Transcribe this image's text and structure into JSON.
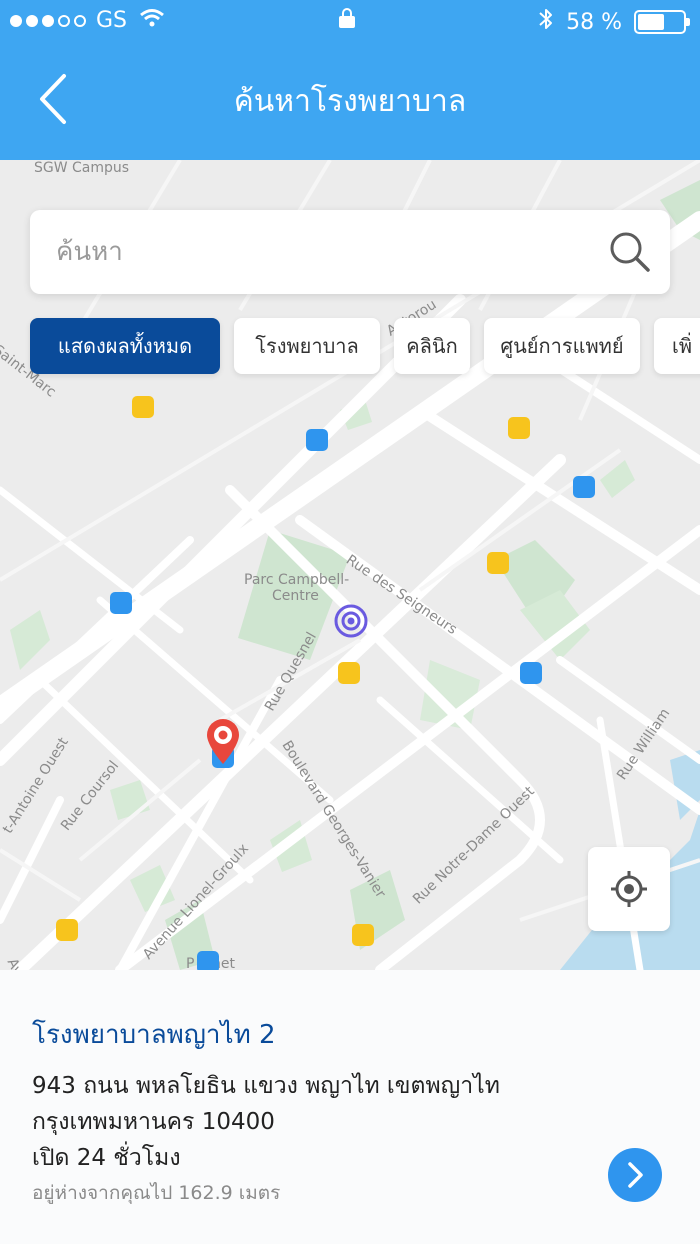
{
  "status_bar": {
    "carrier": "GS",
    "battery": "58 %",
    "battery_level": 0.58
  },
  "header": {
    "title": "ค้นหาโรงพยาบาล"
  },
  "search": {
    "placeholder": "ค้นหา"
  },
  "filters": [
    {
      "label": "แสดงผลทั้งหมด",
      "active": true
    },
    {
      "label": "โรงพยาบาล",
      "active": false
    },
    {
      "label": "คลินิก",
      "active": false
    },
    {
      "label": "ศูนย์การแพทย์",
      "active": false
    },
    {
      "label": "เพิ่",
      "active": false
    }
  ],
  "map": {
    "labels": {
      "campus": "SGW Campus",
      "park": "Parc Campbell-",
      "park2": "Centre",
      "seigneurs": "Rue des Seigneurs",
      "quesnel": "Rue Quesnel",
      "autoroute": "Autorou",
      "saint_marc": "Saint-Marc",
      "antoine": "t-Antoine Ouest",
      "coursol": "Rue Coursol",
      "vanier": "Boulevard Georges-Vanier",
      "notre_dame": "Rue Notre-Dame Ouest",
      "william": "Rue William",
      "groulx": "Avenue Lionel-Groulx",
      "vinet": "P  Vinet",
      "ave": "Ave"
    },
    "colors": {
      "hospital": "#2f95ee",
      "clinic": "#f7c41d",
      "selected_pin": "#e8473c",
      "user_location": "#6a5ae0"
    }
  },
  "card": {
    "name": "โรงพยาบาลพญาไท 2",
    "address_line1": "943 ถนน พหลโยธิน แขวง พญาไท เขตพญาไท",
    "address_line2": "กรุงเทพมหานคร 10400",
    "hours": "เปิด 24 ชั่วโมง",
    "distance": "อยู่ห่างจากคุณไป 162.9 เมตร"
  }
}
